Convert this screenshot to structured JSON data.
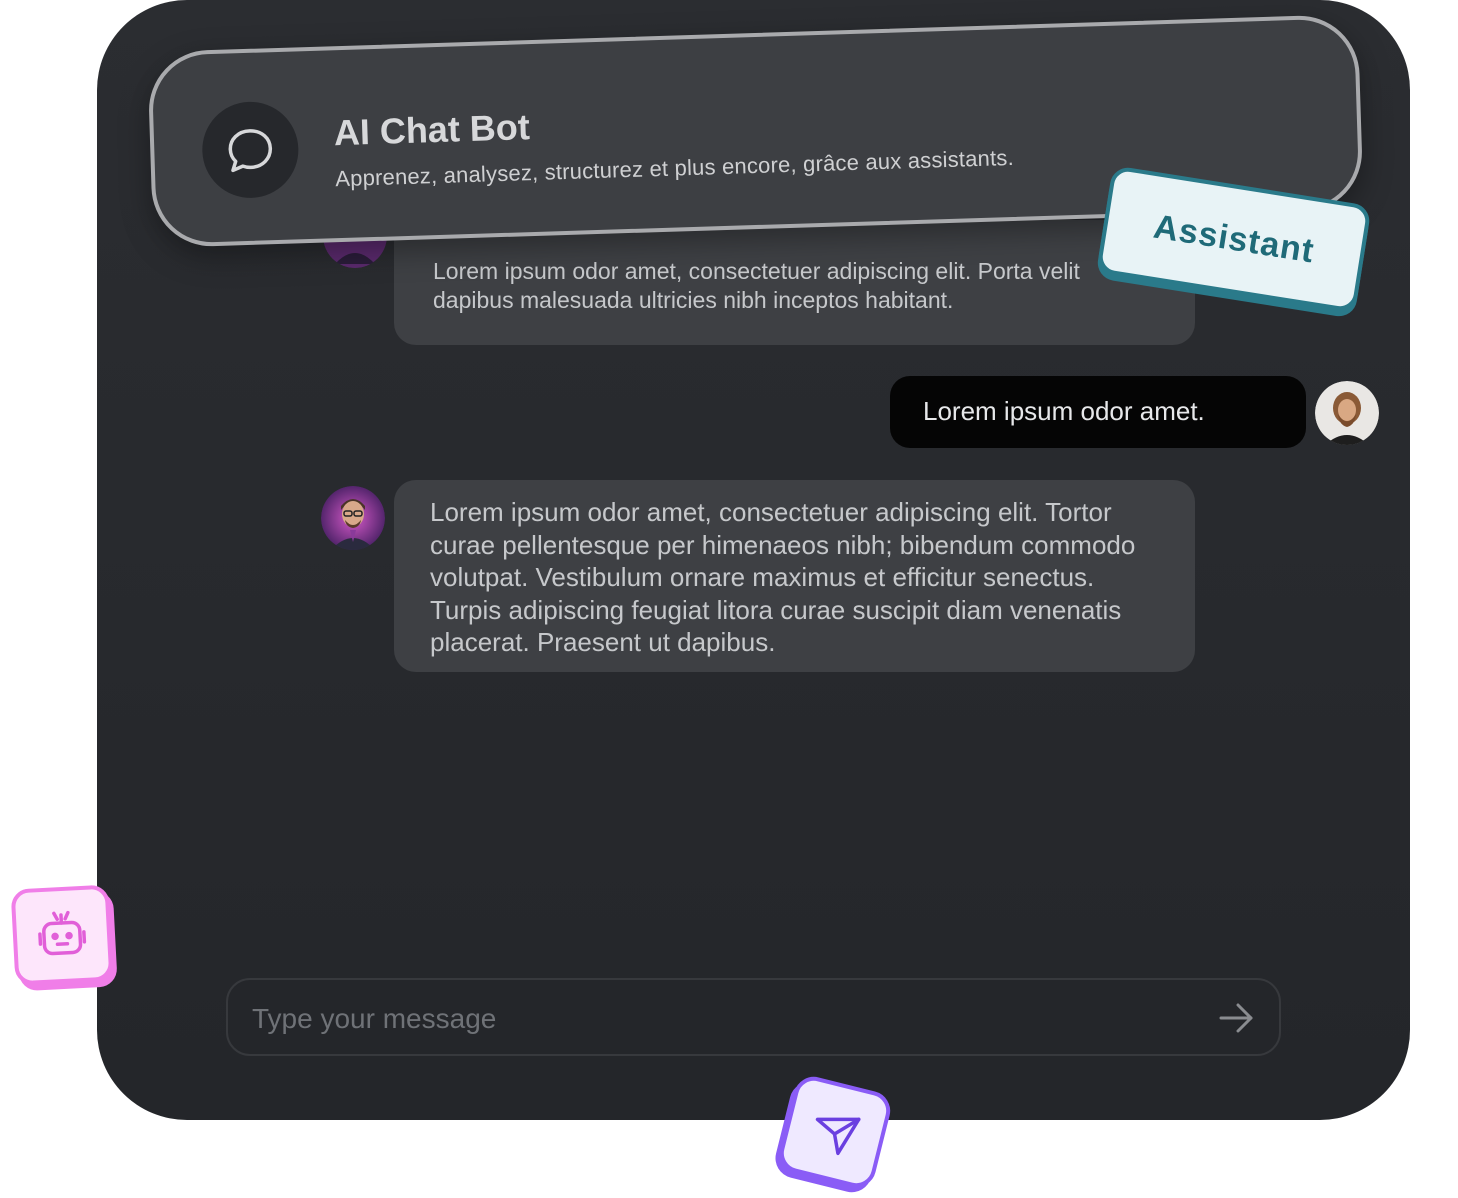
{
  "header": {
    "title": "AI Chat Bot",
    "subtitle": "Apprenez, analysez, structurez et plus encore, grâce aux assistants.",
    "icon": "chat-bubble-icon"
  },
  "tag": {
    "label": "Assistant"
  },
  "messages": [
    {
      "sender": "bot",
      "text": "Lorem ipsum odor amet, consectetuer adipiscing elit. Porta velit dapibus malesuada ultricies nibh inceptos habitant."
    },
    {
      "sender": "user",
      "text": "Lorem ipsum odor amet."
    },
    {
      "sender": "bot",
      "text": "Lorem ipsum odor amet, consectetuer adipiscing elit. Tortor curae pellentesque per himenaeos nibh; bibendum commodo volutpat. Vestibulum ornare maximus et efficitur senectus. Turpis adipiscing feugiat litora curae suscipit diam venenatis placerat. Praesent ut dapibus."
    }
  ],
  "composer": {
    "placeholder": "Type your message",
    "send_icon": "arrow-right-icon"
  },
  "badges": {
    "robot_icon": "robot-icon",
    "send_icon": "paper-plane-icon"
  },
  "colors": {
    "panel": "#26282c",
    "bubble": "#3e4044",
    "user_bubble": "#050505",
    "accent_teal": "#2a7a8a",
    "accent_pink": "#f07ee8",
    "accent_purple": "#8a5cf6"
  }
}
